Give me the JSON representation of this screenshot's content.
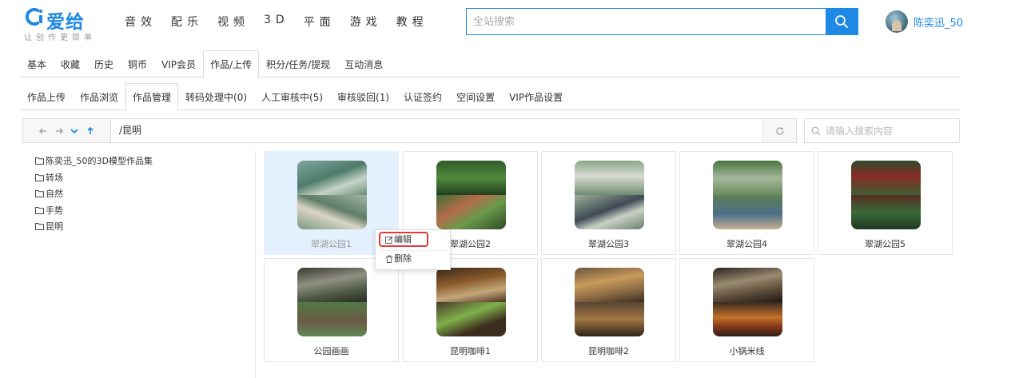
{
  "brand": {
    "name": "爱给",
    "slogan": "让创作更简单",
    "color": "#1e88e5"
  },
  "main_nav": [
    "音效",
    "配乐",
    "视频",
    "3D",
    "平面",
    "游戏",
    "教程"
  ],
  "search": {
    "placeholder": "全站搜索",
    "button_icon": "search-icon"
  },
  "user": {
    "name": "陈奕迅_50"
  },
  "tabs_primary": {
    "items": [
      "基本",
      "收藏",
      "历史",
      "铜币",
      "VIP会员",
      "作品/上传",
      "积分/任务/提现",
      "互动消息"
    ],
    "active": "作品/上传"
  },
  "tabs_secondary": {
    "items": [
      "作品上传",
      "作品浏览",
      "作品管理",
      "转码处理中(0)",
      "人工审核中(5)",
      "审核驳回(1)",
      "认证签约",
      "空间设置",
      "VIP作品设置"
    ],
    "active": "作品管理"
  },
  "path_bar": {
    "path": "/昆明",
    "file_search_placeholder": "请输入搜索内容"
  },
  "folder_tree": [
    "陈奕迅_50的3D模型作品集",
    "转场",
    "自然",
    "手势",
    "昆明"
  ],
  "works": [
    {
      "title": "翠湖公园1",
      "selected": true
    },
    {
      "title": "翠湖公园2",
      "selected": false
    },
    {
      "title": "翠湖公园3",
      "selected": false
    },
    {
      "title": "翠湖公园4",
      "selected": false
    },
    {
      "title": "翠湖公园5",
      "selected": false
    },
    {
      "title": "公园画画",
      "selected": false
    },
    {
      "title": "昆明咖啡1",
      "selected": false
    },
    {
      "title": "昆明咖啡2",
      "selected": false
    },
    {
      "title": "小锅米线",
      "selected": false
    }
  ],
  "context_menu": {
    "edit_label": "编辑",
    "delete_label": "删除"
  }
}
